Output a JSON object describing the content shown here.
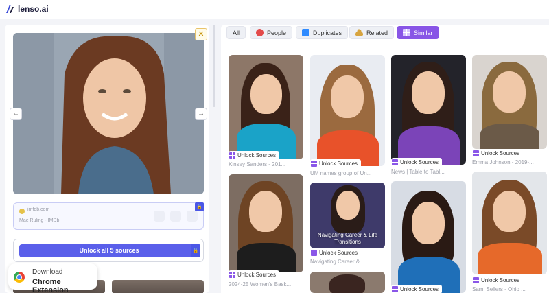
{
  "app": {
    "logo_text": "lenso.ai"
  },
  "source_card": {
    "site": "imfdb.com",
    "title": "Mae Ruling - IMDb"
  },
  "unlock": {
    "label": "Unlock all 5 sources"
  },
  "chrome_ext": {
    "line1": "Download",
    "line2": "Chrome Extension"
  },
  "filters": [
    {
      "label": "All",
      "icon": "all",
      "active": false
    },
    {
      "label": "People",
      "icon": "people-icon",
      "active": false
    },
    {
      "label": "Duplicates",
      "icon": "duplicates-icon",
      "active": false
    },
    {
      "label": "Related",
      "icon": "related-icon",
      "active": false
    },
    {
      "label": "Similar",
      "icon": "similar-icon",
      "active": true
    }
  ],
  "results": {
    "unlock_label": "Unlock Sources",
    "cards": [
      {
        "caption": "Kinsey Sanders - 201..."
      },
      {
        "caption": "UM names group of Un..."
      },
      {
        "caption": "News | Table to Tabl..."
      },
      {
        "caption": "Emma Johnson - 2019-..."
      },
      {
        "caption": "2024-25 Women's Bask..."
      },
      {
        "caption": "Navigating Career & ...",
        "overlay": "Navigating Career & Life Transitions"
      },
      {
        "caption": ""
      },
      {
        "caption": "Sami Sellers - Ohio ..."
      },
      {
        "caption": ""
      }
    ]
  },
  "colors": {
    "accent": "#8855e6",
    "unlock_button": "#5a5fea"
  }
}
